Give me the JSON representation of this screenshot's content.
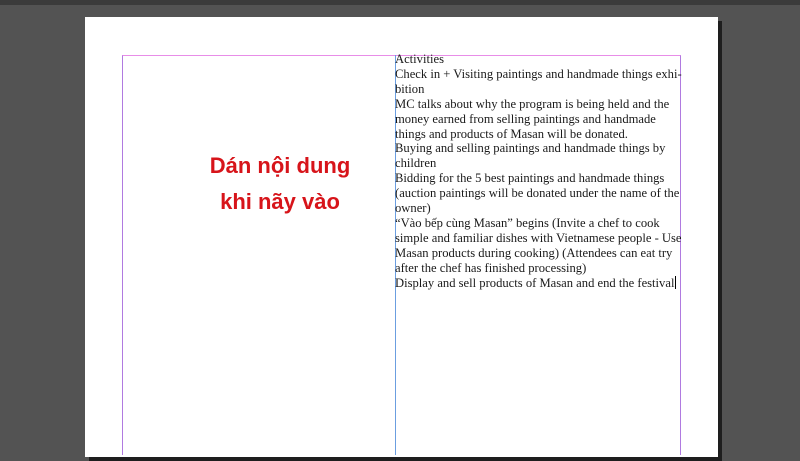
{
  "note": {
    "line1": "Dán nội dung",
    "line2": "khi nãy vào"
  },
  "story_lines": [
    "Activities",
    "Check in + Visiting paintings and handmade things exhi-",
    "bition",
    "MC talks about why the program is being held and the",
    "money earned from selling paintings and handmade",
    "things and products of Masan will be donated.",
    "Buying and selling paintings and handmade things by",
    "children",
    "Bidding for the 5 best paintings and handmade things",
    "(auction paintings will be donated under the name of the",
    "owner)",
    "“Vào bếp cùng Masan” begins (Invite a chef to cook",
    "simple and familiar dishes with Vietnamese people - Use",
    "Masan products during cooking) (Attendees can eat  try",
    "after the chef has finished processing)",
    "Display and sell products of Masan and end the festival"
  ]
}
